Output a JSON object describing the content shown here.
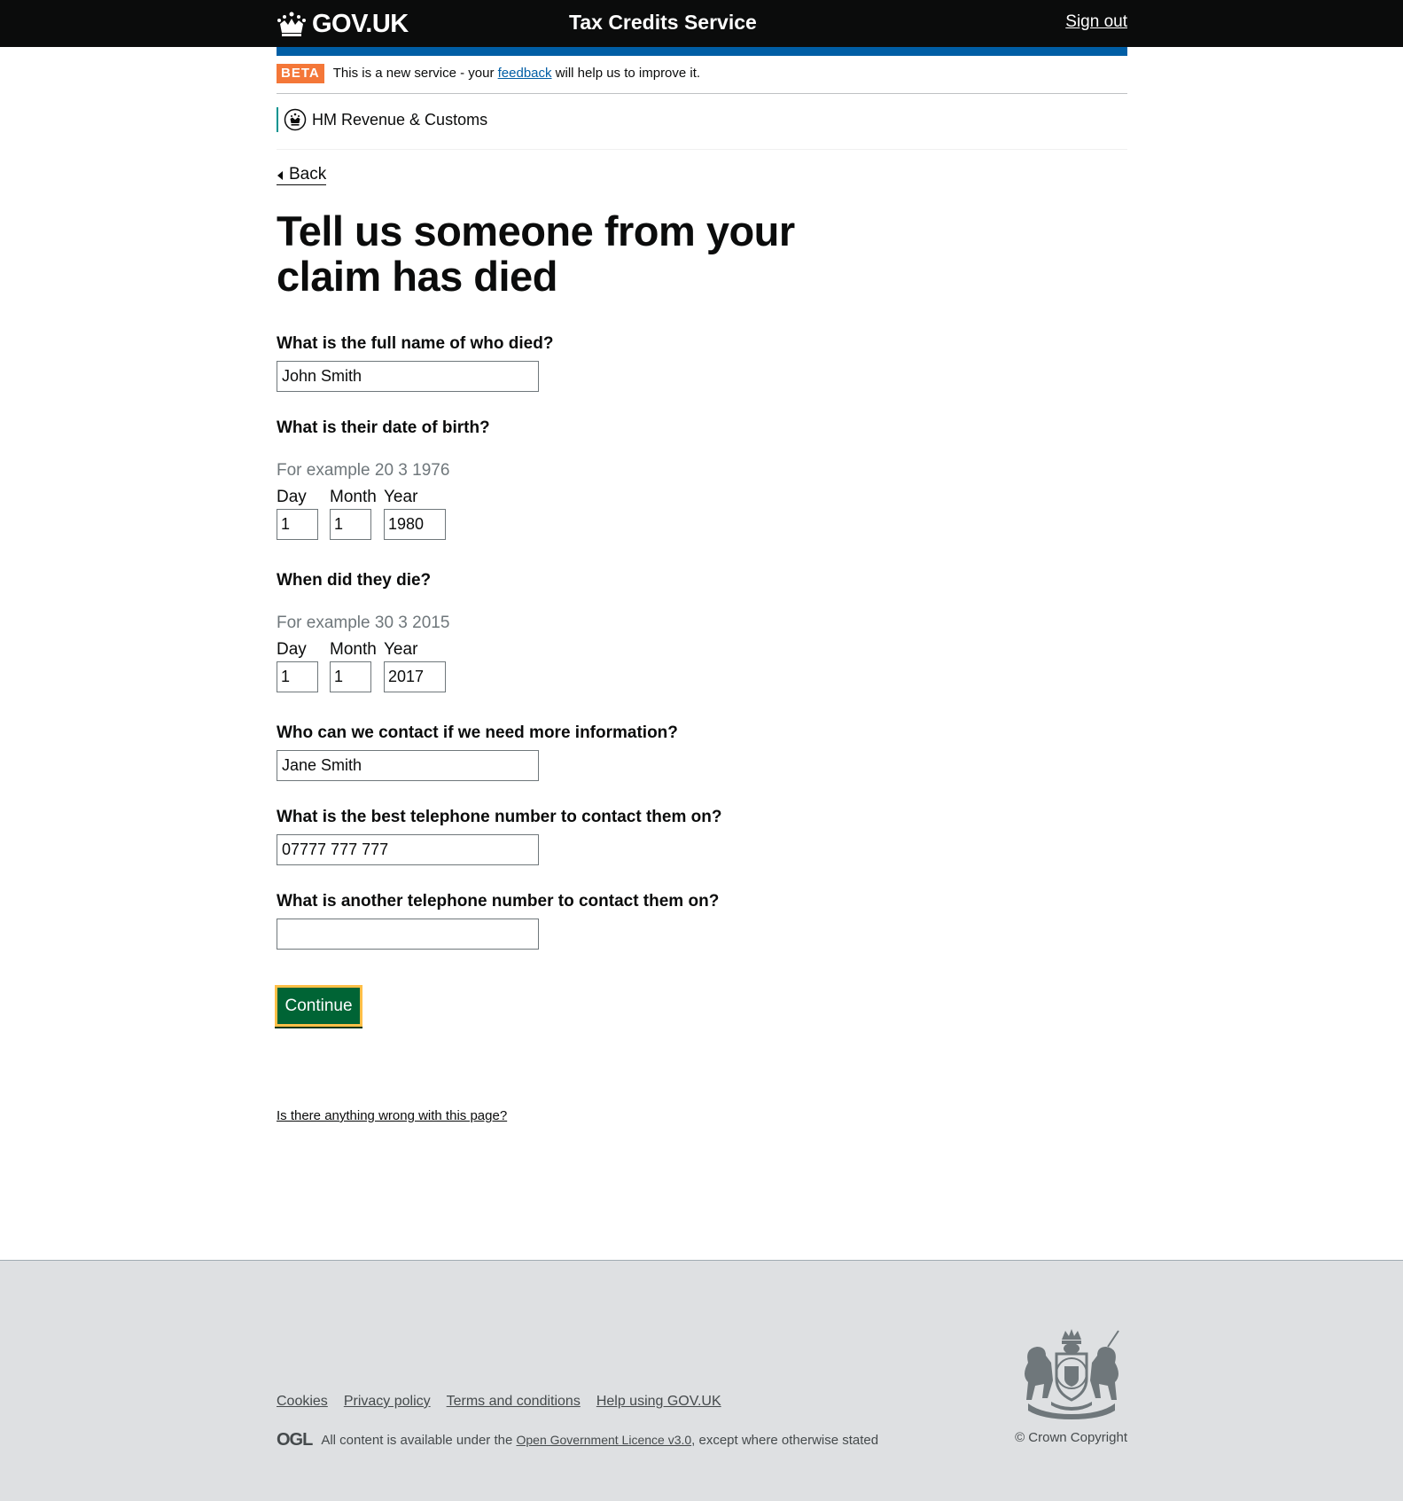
{
  "header": {
    "logo_text": "GOV.UK",
    "service_name": "Tax Credits Service",
    "sign_out": "Sign out"
  },
  "phase_banner": {
    "tag": "BETA",
    "text_before": "This is a new service - your ",
    "link": "feedback",
    "text_after": " will help us to improve it."
  },
  "org": {
    "name": "HM Revenue & Customs"
  },
  "back_link": "Back",
  "heading": "Tell us someone from your claim has died",
  "form": {
    "full_name": {
      "label": "What is the full name of who died?",
      "value": "John Smith"
    },
    "dob": {
      "label": "What is their date of birth?",
      "hint": "For example 20 3 1976",
      "day_label": "Day",
      "month_label": "Month",
      "year_label": "Year",
      "day": "1",
      "month": "1",
      "year": "1980"
    },
    "dod": {
      "label": "When did they die?",
      "hint": "For example 30 3 2015",
      "day_label": "Day",
      "month_label": "Month",
      "year_label": "Year",
      "day": "1",
      "month": "1",
      "year": "2017"
    },
    "contact_name": {
      "label": "Who can we contact if we need more information?",
      "value": "Jane Smith"
    },
    "phone": {
      "label": "What is the best telephone number to contact them on?",
      "value": "07777 777 777"
    },
    "alt_phone": {
      "label": "What is another telephone number to contact them on?",
      "value": ""
    },
    "continue": "Continue"
  },
  "report_link": "Is there anything wrong with this page?",
  "footer": {
    "links": [
      "Cookies",
      "Privacy policy",
      "Terms and conditions",
      "Help using GOV.UK"
    ],
    "ogl": "OGL",
    "licence_before": "All content is available under the ",
    "licence_link": "Open Government Licence v3.0",
    "licence_after": ", except where otherwise stated",
    "copyright": "© Crown Copyright"
  },
  "colors": {
    "header_bg": "#0b0c0c",
    "brand_blue": "#005ea5",
    "beta_orange": "#f47738",
    "button_green": "#006435",
    "focus_yellow": "#ffbf47",
    "hmrc_teal": "#009390",
    "footer_bg": "#dee0e2"
  },
  "icons": [
    "crown-icon",
    "hmrc-crest-icon",
    "back-arrow-icon",
    "ogl-logo",
    "royal-arms-icon"
  ]
}
